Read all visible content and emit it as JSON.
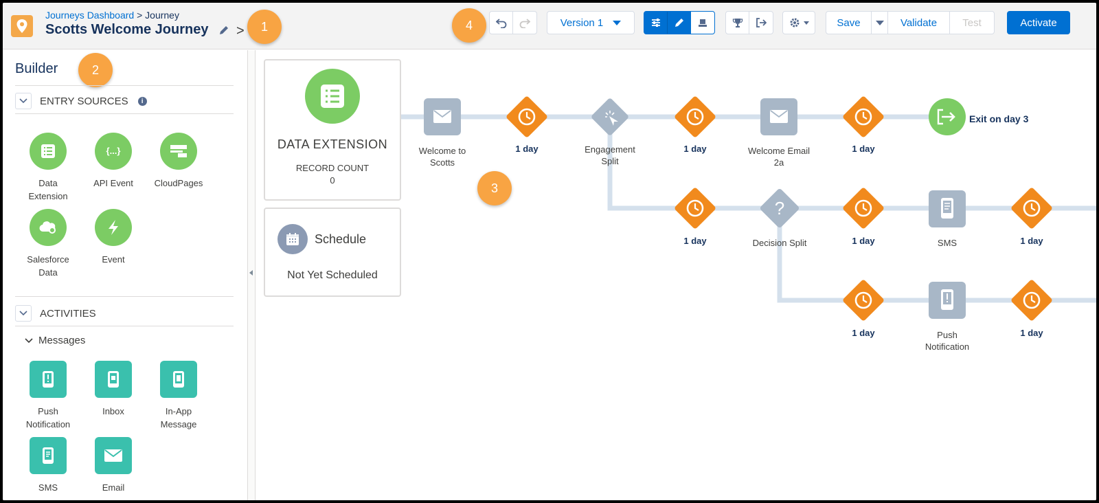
{
  "header": {
    "breadcrumb_link": "Journeys Dashboard",
    "breadcrumb_sep": ">",
    "breadcrumb_current": "Journey",
    "title": "Scotts Welcome Journey",
    "title_chevron": ">",
    "version_label": "Version 1",
    "save_label": "Save",
    "validate_label": "Validate",
    "test_label": "Test",
    "activate_label": "Activate"
  },
  "callouts": [
    "1",
    "2",
    "3",
    "4"
  ],
  "builder": {
    "title": "Builder",
    "entry_sources_title": "ENTRY SOURCES",
    "entry_sources": [
      {
        "label_line1": "Data",
        "label_line2": "Extension",
        "icon": "data-extension-icon"
      },
      {
        "label_line1": "API Event",
        "label_line2": "",
        "icon": "api-event-icon"
      },
      {
        "label_line1": "CloudPages",
        "label_line2": "",
        "icon": "cloudpages-icon"
      },
      {
        "label_line1": "Salesforce",
        "label_line2": "Data",
        "icon": "salesforce-data-icon"
      },
      {
        "label_line1": "Event",
        "label_line2": "",
        "icon": "event-icon"
      }
    ],
    "activities_title": "ACTIVITIES",
    "messages_title": "Messages",
    "messages": [
      {
        "label_line1": "Push",
        "label_line2": "Notification",
        "icon": "push-notification-icon"
      },
      {
        "label_line1": "Inbox",
        "label_line2": "",
        "icon": "inbox-icon"
      },
      {
        "label_line1": "In-App",
        "label_line2": "Message",
        "icon": "in-app-message-icon"
      },
      {
        "label_line1": "SMS",
        "label_line2": "",
        "icon": "sms-icon"
      },
      {
        "label_line1": "Email",
        "label_line2": "",
        "icon": "email-icon"
      }
    ]
  },
  "canvas": {
    "entry_card": {
      "name": "DATA EXTENSION",
      "record_count_label": "RECORD COUNT",
      "record_count": "0"
    },
    "schedule_card": {
      "label": "Schedule",
      "status": "Not Yet Scheduled"
    },
    "nodes": {
      "welcome_to_scotts_l1": "Welcome to",
      "welcome_to_scotts_l2": "Scotts",
      "engagement_split_l1": "Engagement",
      "engagement_split_l2": "Split",
      "welcome_email_l1": "Welcome Email",
      "welcome_email_l2": "2a",
      "exit": "Exit on day 3",
      "decision_split": "Decision Split",
      "sms": "SMS",
      "push_l1": "Push",
      "push_l2": "Notification"
    },
    "wait_label": "1 day"
  },
  "colors": {
    "accent": "#0070d2",
    "wait_orange": "#f18a1d",
    "entry_green": "#7ccc64",
    "message_teal": "#3ac0ad",
    "callout_orange": "#f8a443",
    "node_gray": "#a8b7c7"
  }
}
